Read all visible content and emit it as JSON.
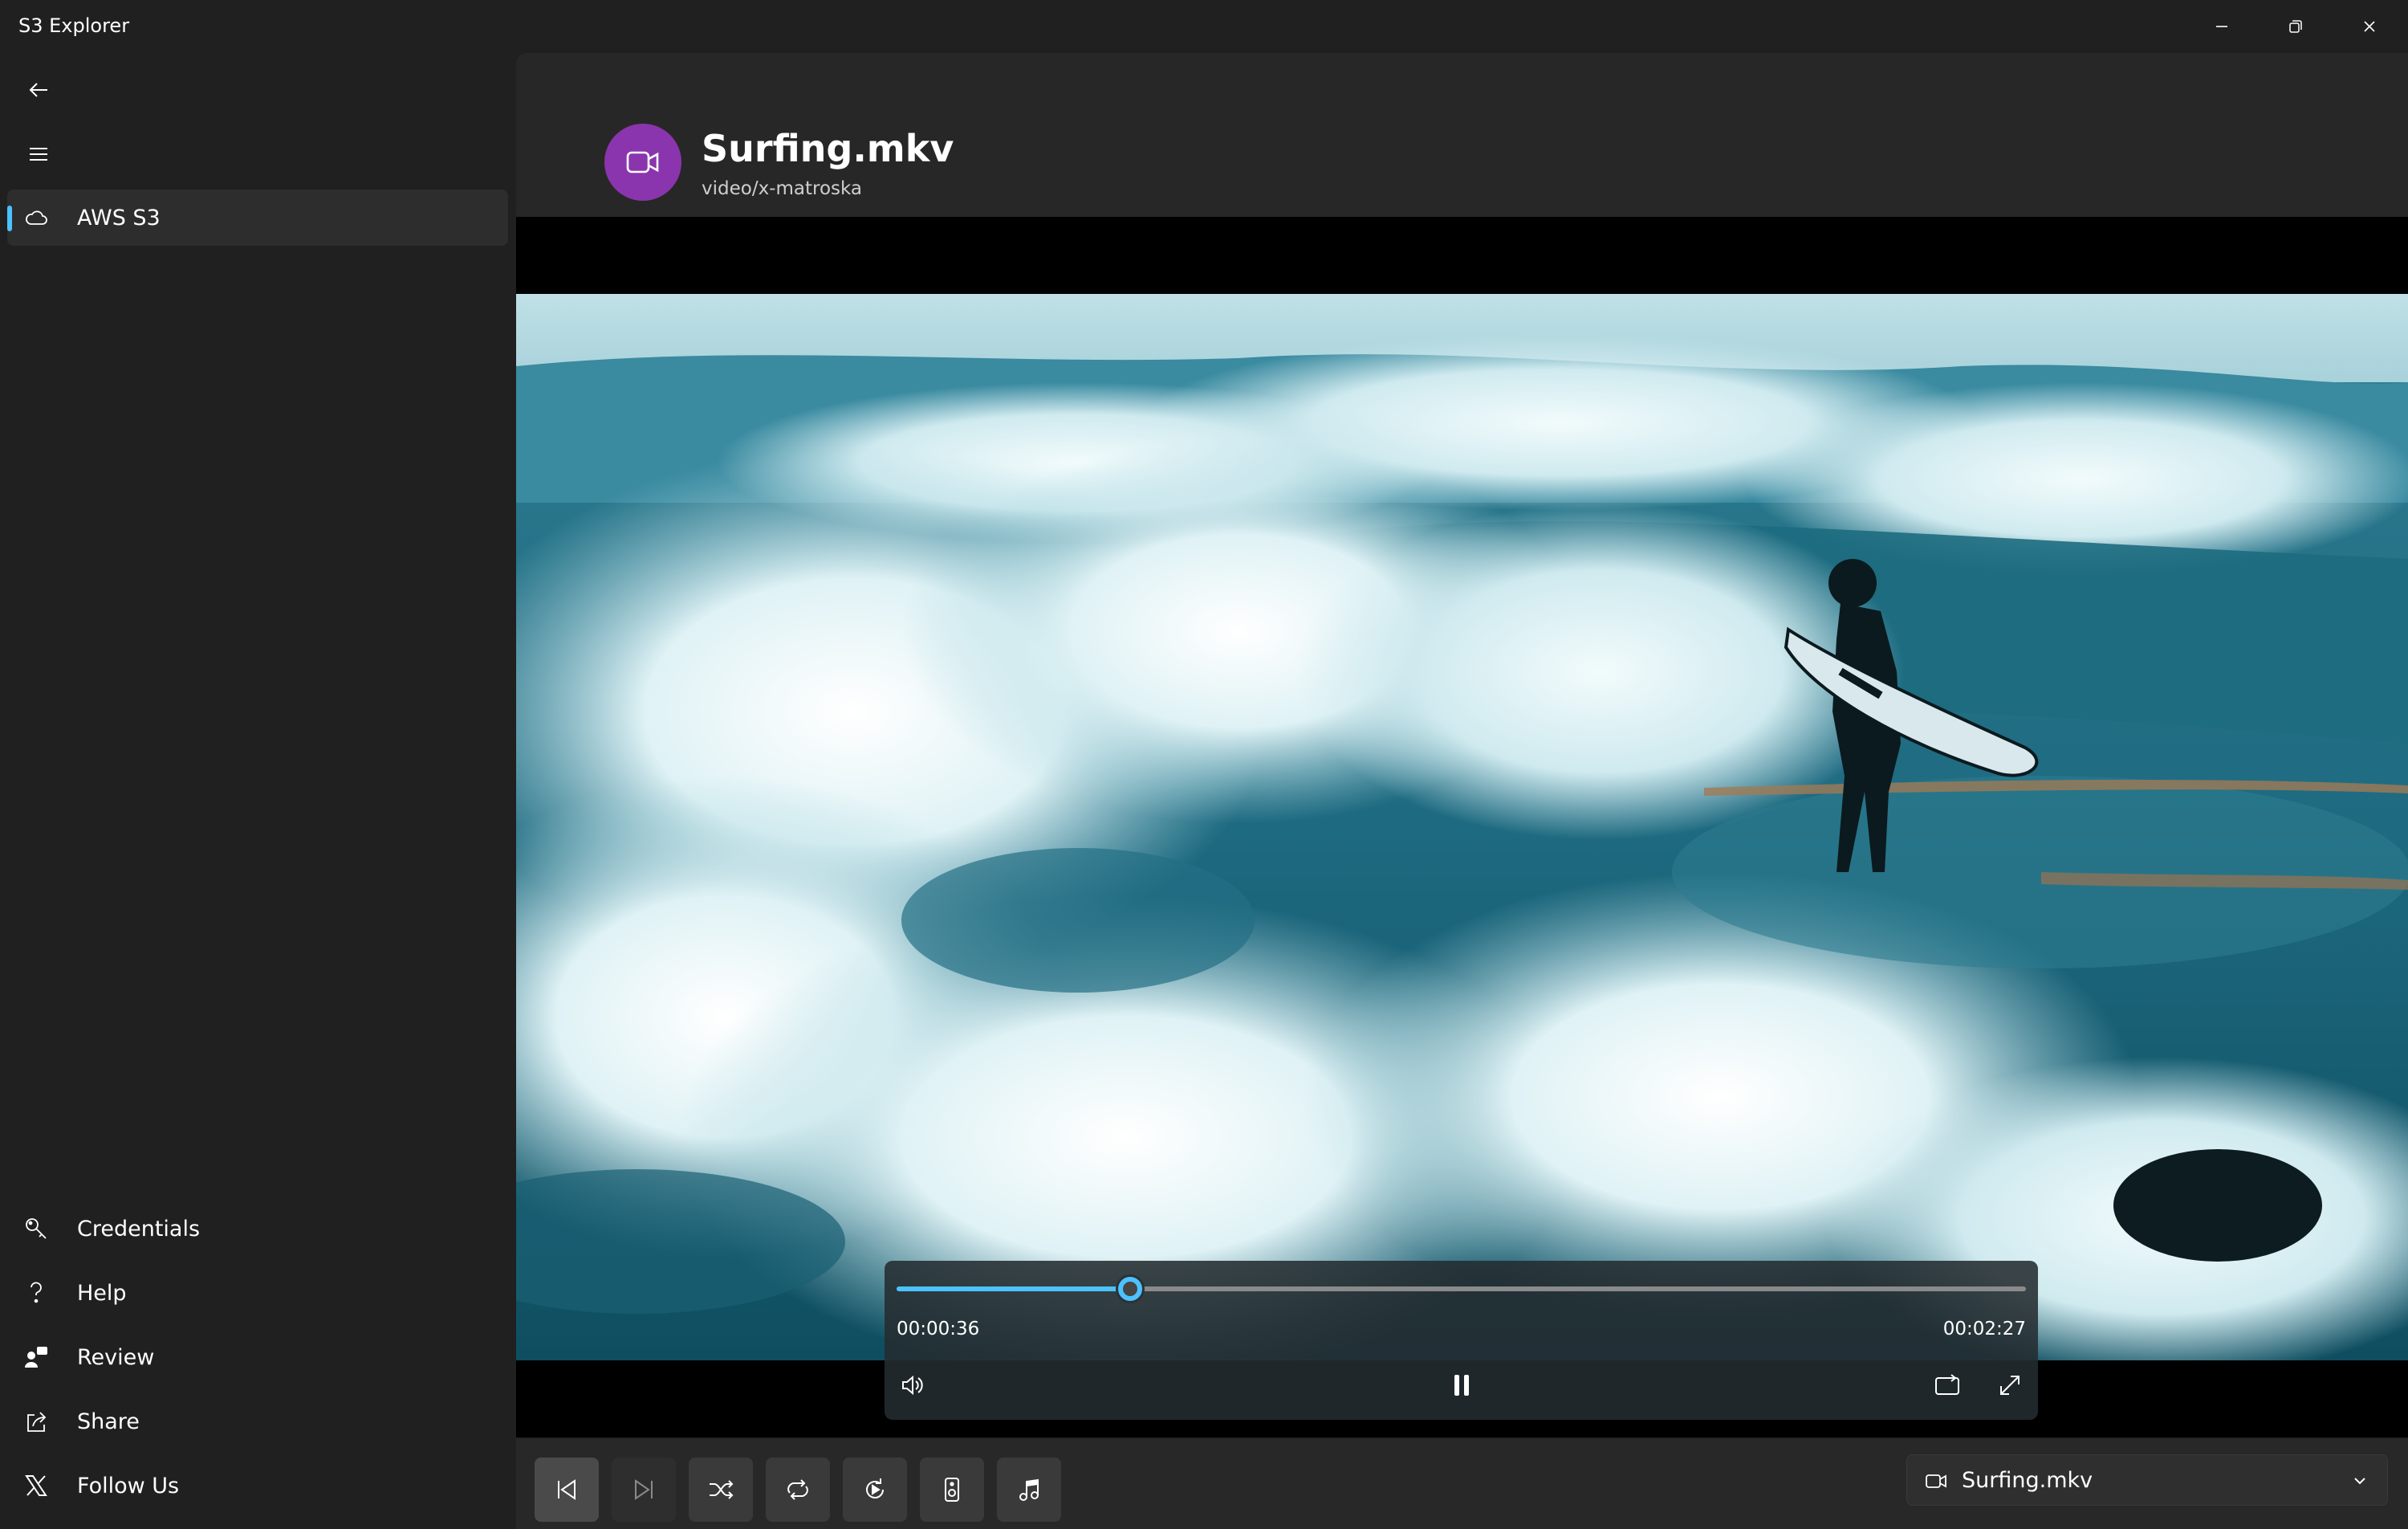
{
  "app": {
    "title": "S3 Explorer"
  },
  "sidebar": {
    "primary_items": [
      {
        "label": "AWS S3",
        "icon": "cloud-icon",
        "selected": true
      }
    ],
    "footer_items": [
      {
        "label": "Credentials",
        "icon": "key-icon"
      },
      {
        "label": "Help",
        "icon": "question-icon"
      },
      {
        "label": "Review",
        "icon": "person-feedback-icon"
      },
      {
        "label": "Share",
        "icon": "share-icon"
      },
      {
        "label": "Follow Us",
        "icon": "x-logo-icon"
      }
    ]
  },
  "file": {
    "name": "Surfing.mkv",
    "mime": "video/x-matroska",
    "avatar_color": "#8a35ad"
  },
  "player": {
    "elapsed": "00:00:36",
    "remaining": "00:02:27",
    "progress": 0.207,
    "state": "playing"
  },
  "toolbar": {
    "selected_file": "Surfing.mkv",
    "buttons": [
      {
        "name": "previous-button",
        "icon": "skip-previous-icon"
      },
      {
        "name": "next-button",
        "icon": "skip-next-icon"
      },
      {
        "name": "shuffle-button",
        "icon": "shuffle-icon"
      },
      {
        "name": "repeat-button",
        "icon": "repeat-icon"
      },
      {
        "name": "replay-button",
        "icon": "replay-icon"
      },
      {
        "name": "speaker-button",
        "icon": "speaker-icon"
      },
      {
        "name": "music-button",
        "icon": "music-note-icon"
      }
    ]
  },
  "colors": {
    "accent": "#4cc2ff",
    "background": "#202020",
    "content": "#272727"
  }
}
